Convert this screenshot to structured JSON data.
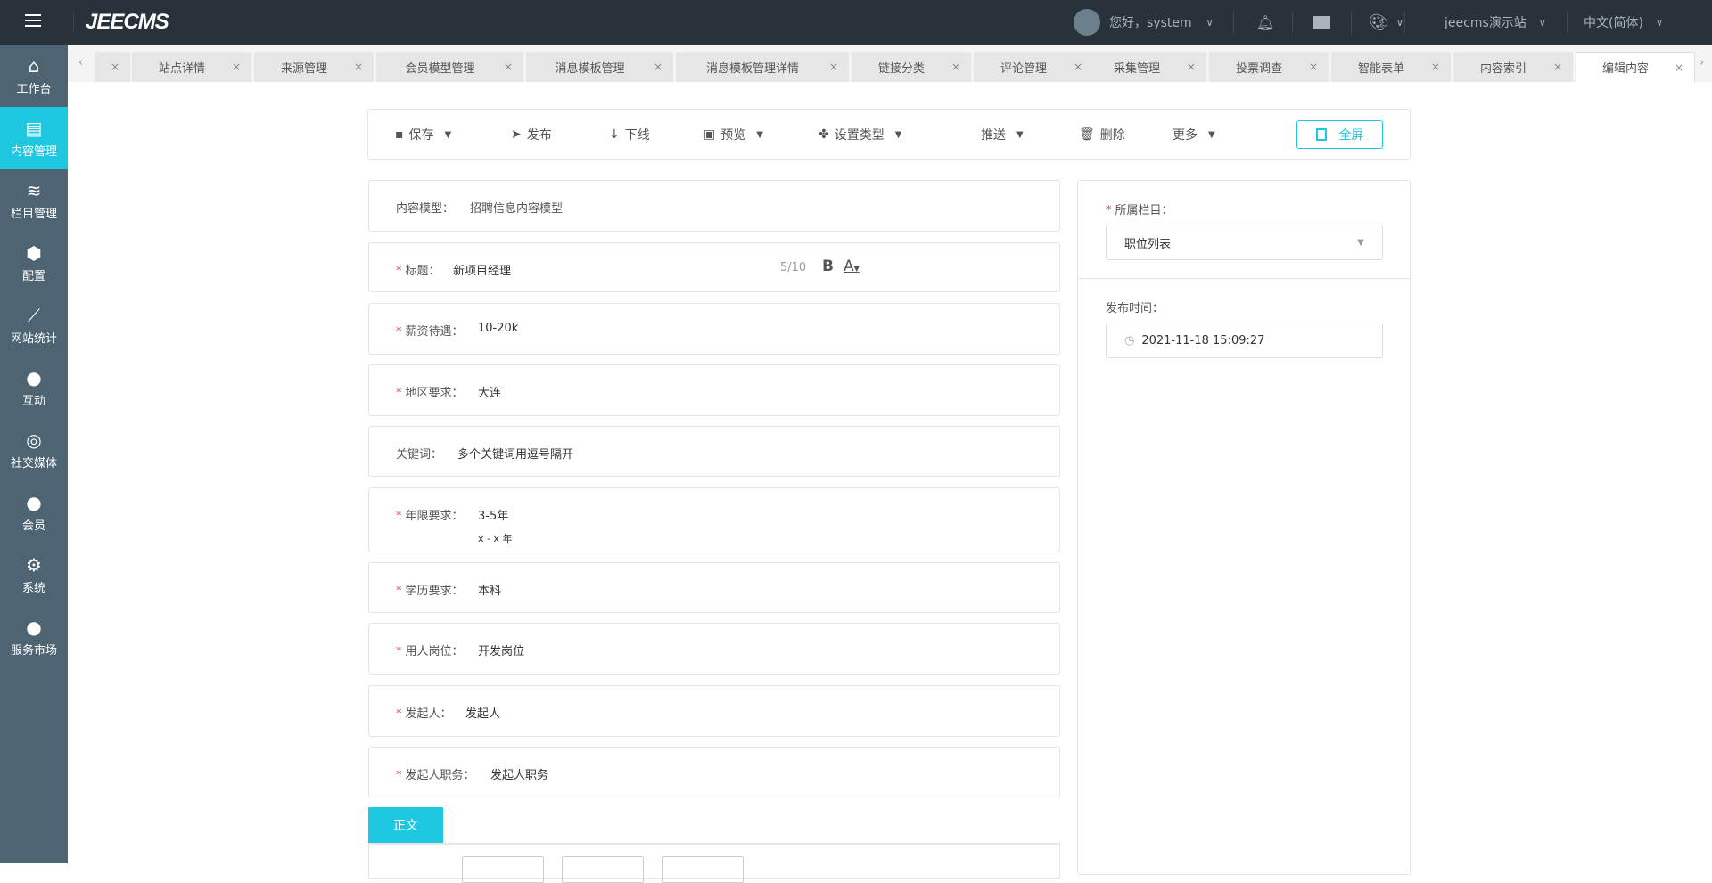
{
  "header": {
    "logo": "JEECMS",
    "greeting": "您好，system",
    "site": "jeecms演示站",
    "language": "中文(简体)"
  },
  "sidebar": {
    "items": [
      {
        "label": "工作台",
        "icon": "home-icon"
      },
      {
        "label": "内容管理",
        "icon": "document-icon"
      },
      {
        "label": "栏目管理",
        "icon": "layers-icon"
      },
      {
        "label": "配置",
        "icon": "cube-icon"
      },
      {
        "label": "网站统计",
        "icon": "chart-icon"
      },
      {
        "label": "互动",
        "icon": "chat-icon"
      },
      {
        "label": "社交媒体",
        "icon": "social-icon"
      },
      {
        "label": "会员",
        "icon": "user-icon"
      },
      {
        "label": "系统",
        "icon": "gear-icon"
      },
      {
        "label": "服务市场",
        "icon": "service-icon"
      }
    ]
  },
  "tabs": [
    {
      "label": ""
    },
    {
      "label": "站点详情"
    },
    {
      "label": "来源管理"
    },
    {
      "label": "会员模型管理"
    },
    {
      "label": "消息模板管理"
    },
    {
      "label": "消息模板管理详情"
    },
    {
      "label": "链接分类"
    },
    {
      "label": "评论管理"
    },
    {
      "label": "采集管理"
    },
    {
      "label": "投票调查"
    },
    {
      "label": "智能表单"
    },
    {
      "label": "内容索引"
    },
    {
      "label": "编辑内容"
    }
  ],
  "toolbar": {
    "save": "保存",
    "publish": "发布",
    "offline": "下线",
    "preview": "预览",
    "set_type": "设置类型",
    "push": "推送",
    "delete": "删除",
    "more": "更多",
    "fullscreen": "全屏"
  },
  "form": {
    "model_label": "内容模型：",
    "model_value": "招聘信息内容模型",
    "title_label": "标题：",
    "title_value": "新项目经理",
    "title_count": "5/10",
    "salary_label": "薪资待遇：",
    "salary_value": "10-20k",
    "region_label": "地区要求：",
    "region_value": "大连",
    "keywords_label": "关键词：",
    "keywords_placeholder": "多个关键词用逗号隔开",
    "years_label": "年限要求：",
    "years_value": "3-5年",
    "years_hint": "x - x 年",
    "edu_label": "学历要求：",
    "edu_value": "本科",
    "post_label": "用人岗位：",
    "post_value": "开发岗位",
    "initiator_label": "发起人：",
    "initiator_value": "发起人",
    "initiator_title_label": "发起人职务：",
    "initiator_title_value": "发起人职务",
    "body_tab": "正文"
  },
  "right": {
    "channel_label": "所属栏目：",
    "channel_value": "职位列表",
    "time_label": "发布时间：",
    "time_value": "2021-11-18 15:09:27"
  }
}
